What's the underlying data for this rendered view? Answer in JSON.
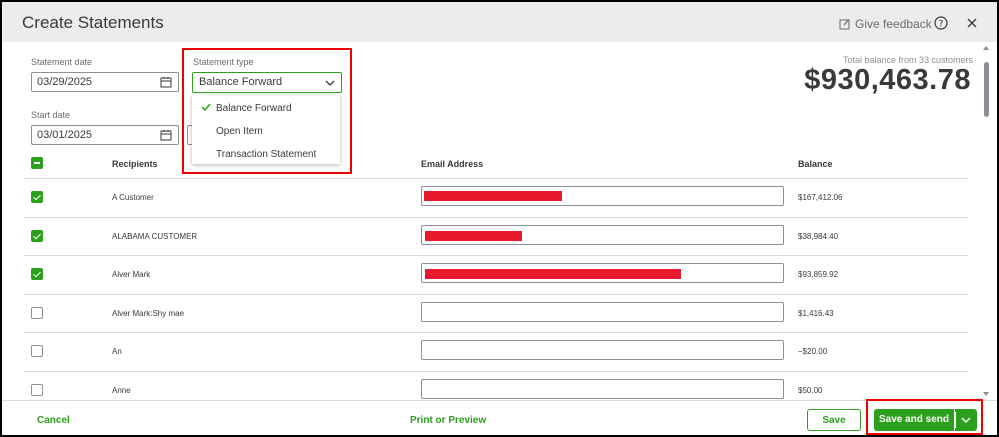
{
  "header": {
    "title": "Create Statements",
    "feedback_label": "Give feedback"
  },
  "form": {
    "statement_date_label": "Statement date",
    "statement_date_value": "03/29/2025",
    "start_date_label": "Start date",
    "start_date_value": "03/01/2025",
    "statement_type_label": "Statement type",
    "statement_type_value": "Balance Forward",
    "statement_type_options": [
      "Balance Forward",
      "Open Item",
      "Transaction Statement"
    ]
  },
  "summary": {
    "total_label": "Total balance from 33 customers",
    "total_amount": "$930,463.78"
  },
  "table": {
    "columns": [
      "Recipients",
      "Email Address",
      "Balance"
    ],
    "rows": [
      {
        "name": "A Customer",
        "checked": true,
        "balance": "$167,412.06",
        "email_redacted": true
      },
      {
        "name": "ALABAMA CUSTOMER",
        "checked": true,
        "balance": "$38,984.40",
        "email_redacted": true
      },
      {
        "name": "Alver Mark",
        "checked": true,
        "balance": "$93,859.92",
        "email_redacted": true
      },
      {
        "name": "Alver Mark:Shy mae",
        "checked": false,
        "balance": "$1,416.43",
        "email_redacted": false
      },
      {
        "name": "An",
        "checked": false,
        "balance": "−$20.00",
        "email_redacted": false
      },
      {
        "name": "Anne",
        "checked": false,
        "balance": "$50.00",
        "email_redacted": false
      }
    ]
  },
  "footer": {
    "cancel": "Cancel",
    "print_preview": "Print or Preview",
    "save": "Save",
    "save_and_send": "Save and send"
  },
  "colors": {
    "accent": "#2ca01c",
    "highlight": "#e00000",
    "redaction": "#e8192c"
  }
}
